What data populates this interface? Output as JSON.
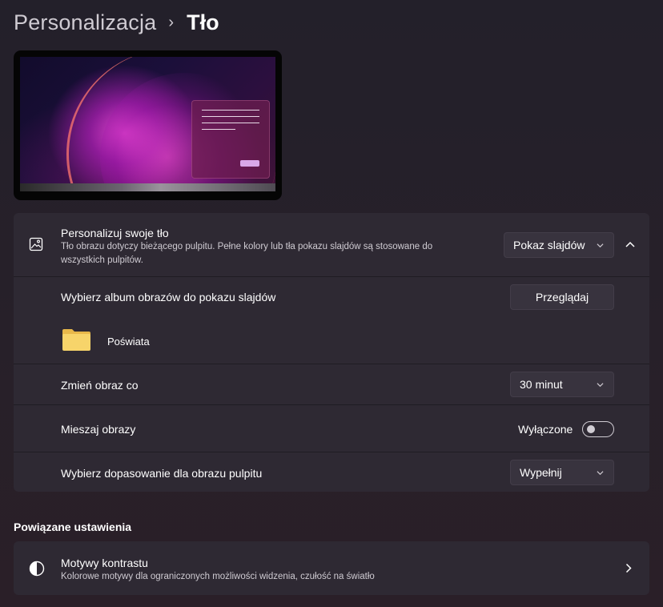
{
  "breadcrumb": {
    "parent": "Personalizacja",
    "separator": "›",
    "current": "Tło"
  },
  "background_card": {
    "title": "Personalizuj swoje tło",
    "description": "Tło obrazu dotyczy bieżącego pulpitu. Pełne kolory lub tła pokazu slajdów są stosowane do wszystkich pulpitów.",
    "selected": "Pokaz slajdów",
    "icon": "image-icon",
    "expand_icon": "chevron-up-icon"
  },
  "album": {
    "label": "Wybierz album obrazów do pokazu slajdów",
    "browse_label": "Przeglądaj",
    "folder_name": "Poświata",
    "folder_icon": "folder-icon"
  },
  "interval": {
    "label": "Zmień obraz co",
    "selected": "30 minut"
  },
  "shuffle": {
    "label": "Mieszaj obrazy",
    "state_label": "Wyłączone",
    "enabled": false
  },
  "fit": {
    "label": "Wybierz dopasowanie dla obrazu pulpitu",
    "selected": "Wypełnij"
  },
  "related": {
    "heading": "Powiązane ustawienia",
    "items": [
      {
        "title": "Motywy kontrastu",
        "description": "Kolorowe motywy dla ograniczonych możliwości widzenia, czułość na światło",
        "icon": "contrast-icon"
      }
    ]
  },
  "colors": {
    "background": "#23202a",
    "card": "#2e2933",
    "control": "#38333e",
    "text": "#ffffff",
    "subtext": "#cfcbd2"
  }
}
